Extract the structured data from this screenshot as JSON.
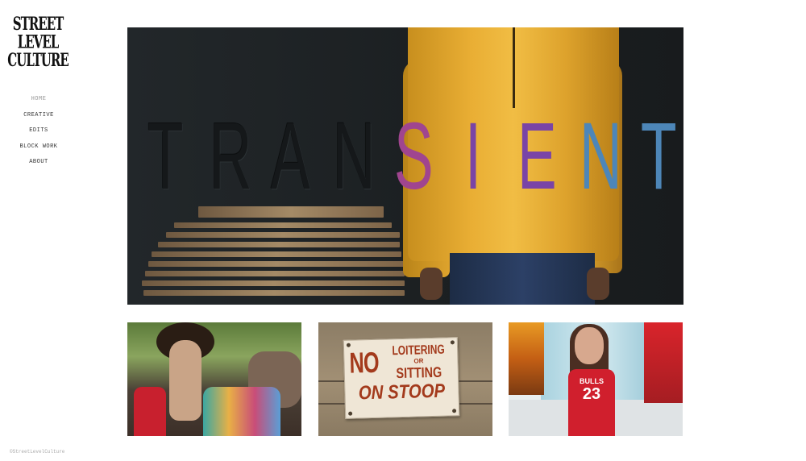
{
  "brand": {
    "logo_text": "STREET LEVEL CULTURE"
  },
  "nav": {
    "items": [
      {
        "label": "HOME"
      },
      {
        "label": "CREATIVE"
      },
      {
        "label": "EDITS"
      },
      {
        "label": "BLOCK WORK"
      },
      {
        "label": "ABOUT"
      }
    ]
  },
  "hero": {
    "word": [
      "T",
      "R",
      "A",
      "N",
      "S",
      "I",
      "E",
      "N",
      "T"
    ]
  },
  "thumbs": [
    {
      "name": "protest-hand"
    },
    {
      "name": "no-loitering-sign",
      "sign_no": "NO",
      "sign_line1": "LOITERING",
      "sign_or": "OR",
      "sign_line2": "SITTING",
      "sign_line3": "ON STOOP"
    },
    {
      "name": "bulls-jersey",
      "jersey_text": "BULLS",
      "jersey_number": "23"
    }
  ],
  "footer": {
    "copyright": "©StreetLevelCulture"
  },
  "colors": {
    "nav_text": "#333333",
    "nav_active": "#999999",
    "hero_bg": "#1e2223"
  }
}
